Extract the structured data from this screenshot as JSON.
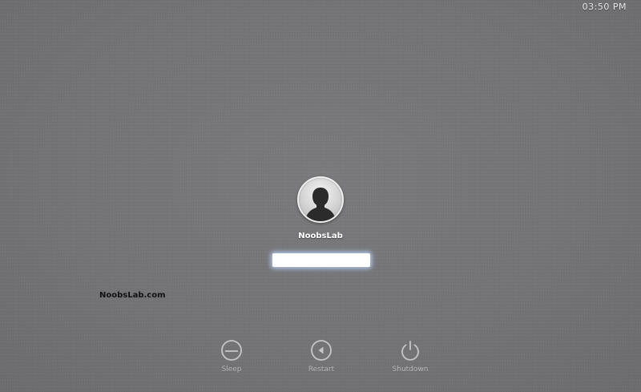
{
  "clock": {
    "time": "03:50 PM"
  },
  "login": {
    "username": "NoobsLab",
    "password_value": ""
  },
  "watermark": {
    "text": "NoobsLab.com"
  },
  "power": {
    "sleep_label": "Sleep",
    "restart_label": "Restart",
    "shutdown_label": "Shutdown"
  },
  "icons": [
    "user-avatar-icon",
    "sleep-icon",
    "restart-icon",
    "shutdown-icon"
  ],
  "colors": {
    "background": "#767679",
    "text_light": "#ffffff",
    "label_gray": "#b9b9bc",
    "input_glow": "#bed7ff"
  }
}
